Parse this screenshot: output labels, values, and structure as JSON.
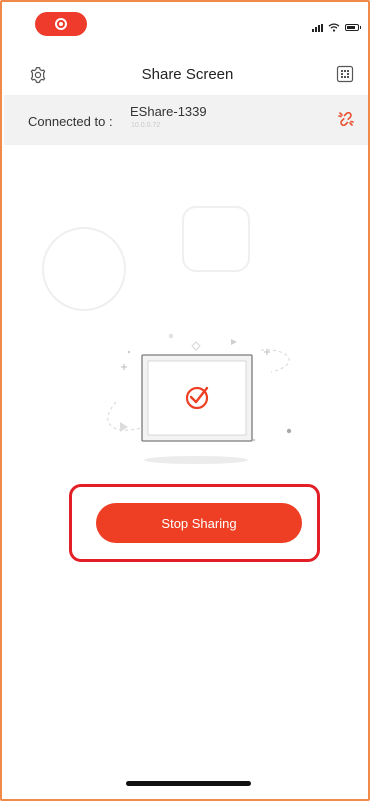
{
  "header": {
    "title": "Share Screen",
    "settings_icon": "gear-icon",
    "scan_icon": "qr-scan-icon"
  },
  "connection": {
    "label": "Connected to :",
    "device_name": "EShare-1339",
    "device_ip": "10.0.0.72",
    "disconnect_icon": "unlink-icon"
  },
  "main": {
    "illustration_icon": "screen-check-icon",
    "stop_button_label": "Stop Sharing"
  },
  "colors": {
    "accent": "#ee3f24",
    "highlight": "#e21f26",
    "frame": "#f08a4b"
  }
}
